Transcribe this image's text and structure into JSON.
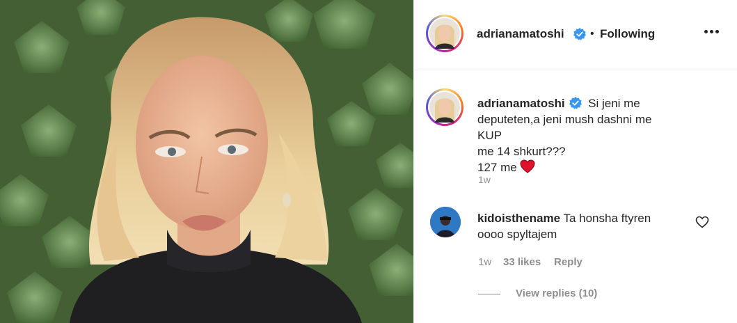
{
  "header": {
    "username": "adrianamatoshi",
    "separator": "•",
    "follow_status": "Following",
    "verified_icon": "verified-badge-icon",
    "more_icon": "more-options-icon"
  },
  "caption": {
    "username": "adrianamatoshi",
    "text_line1": "Si jeni me",
    "text_line2": "deputeten,a jeni mush dashni me KUP",
    "text_line3": "me 14 shkurt???",
    "text_line4": "127 me",
    "emoji": "red-heart-emoji",
    "time": "1w"
  },
  "comments": [
    {
      "username": "kidoisthename",
      "text_line1": "Ta honsha ftyren",
      "text_line2": "oooo spyltajem",
      "time": "1w",
      "likes": "33 likes",
      "reply_label": "Reply",
      "like_icon": "heart-outline-icon",
      "view_replies": "View replies (10)"
    }
  ],
  "colors": {
    "text": "#262626",
    "muted": "#8e8e8e",
    "verified": "#3897f0",
    "heart_red": "#ed4956"
  }
}
